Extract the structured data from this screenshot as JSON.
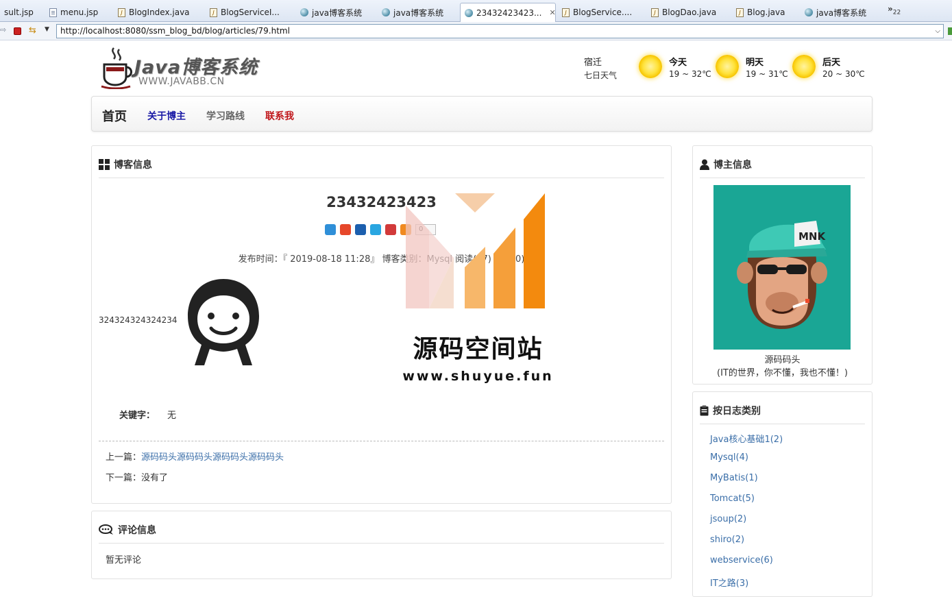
{
  "tabs": [
    {
      "label": "sult.jsp",
      "icon": "file-icon"
    },
    {
      "label": "menu.jsp",
      "icon": "file-icon"
    },
    {
      "label": "BlogIndex.java",
      "icon": "java-file-icon"
    },
    {
      "label": "BlogServiceI...",
      "icon": "java-file-icon"
    },
    {
      "label": "java博客系统",
      "icon": "globe-icon"
    },
    {
      "label": "java博客系统",
      "icon": "globe-icon"
    },
    {
      "label": "23432423423...",
      "icon": "globe-icon",
      "active": true
    },
    {
      "label": "BlogService....",
      "icon": "java-file-icon"
    },
    {
      "label": "BlogDao.java",
      "icon": "java-file-icon"
    },
    {
      "label": "Blog.java",
      "icon": "java-file-icon"
    },
    {
      "label": "java博客系统",
      "icon": "globe-icon"
    }
  ],
  "tab_overflow": {
    "symbol": "»",
    "count": "22"
  },
  "address": {
    "url": "http://localhost:8080/ssm_blog_bd/blog/articles/79.html"
  },
  "header": {
    "logo_title": "Java博客系统",
    "logo_sub": "WWW.JAVABB.CN",
    "weather": {
      "city": "宿迁",
      "note": "七日天气",
      "days": [
        {
          "label": "今天",
          "temp": "19 ~ 32℃",
          "icon": "sun-icon"
        },
        {
          "label": "明天",
          "temp": "19 ~ 31℃",
          "icon": "sun-icon"
        },
        {
          "label": "后天",
          "temp": "20 ~ 30℃",
          "icon": "sun-icon"
        }
      ]
    }
  },
  "nav": {
    "home": "首页",
    "about": "关于博主",
    "path": "学习路线",
    "contact": "联系我"
  },
  "blog_panel": {
    "title": "博客信息",
    "article_title": "23432423423",
    "share_count": "0",
    "meta": "发布时间：『 2019-08-18 11:28』  博客类别：Mysql  阅读(17) 评论(0)",
    "body_text": "324324324324234",
    "keywords_label": "关键字：",
    "keywords_value": "无",
    "prev_label": "上一篇：",
    "prev_link": "源码码头源码码头源码码头源码码头",
    "next_label": "下一篇：",
    "next_value": "没有了"
  },
  "comment_panel": {
    "title": "评论信息",
    "empty": "暂无评论"
  },
  "owner_panel": {
    "title": "博主信息",
    "name": "源码码头",
    "signature": "(IT的世界，你不懂，我也不懂！)",
    "avatar_text": "MNK"
  },
  "category_panel": {
    "title": "按日志类别",
    "items": [
      "Java核心基础1(2)",
      "Mysql(4)",
      "MyBatis(1)",
      "Tomcat(5)",
      "jsoup(2)",
      "shiro(2)",
      "webservice(6)",
      "IT之路(3)"
    ]
  },
  "watermark": {
    "text": "源码空间站",
    "url": "www.shuyue.fun"
  },
  "colors": {
    "link": "#3a6ea8",
    "nav_about": "#1a1aa6",
    "nav_contact": "#c0161a",
    "avatar_bg": "#1aa695"
  }
}
